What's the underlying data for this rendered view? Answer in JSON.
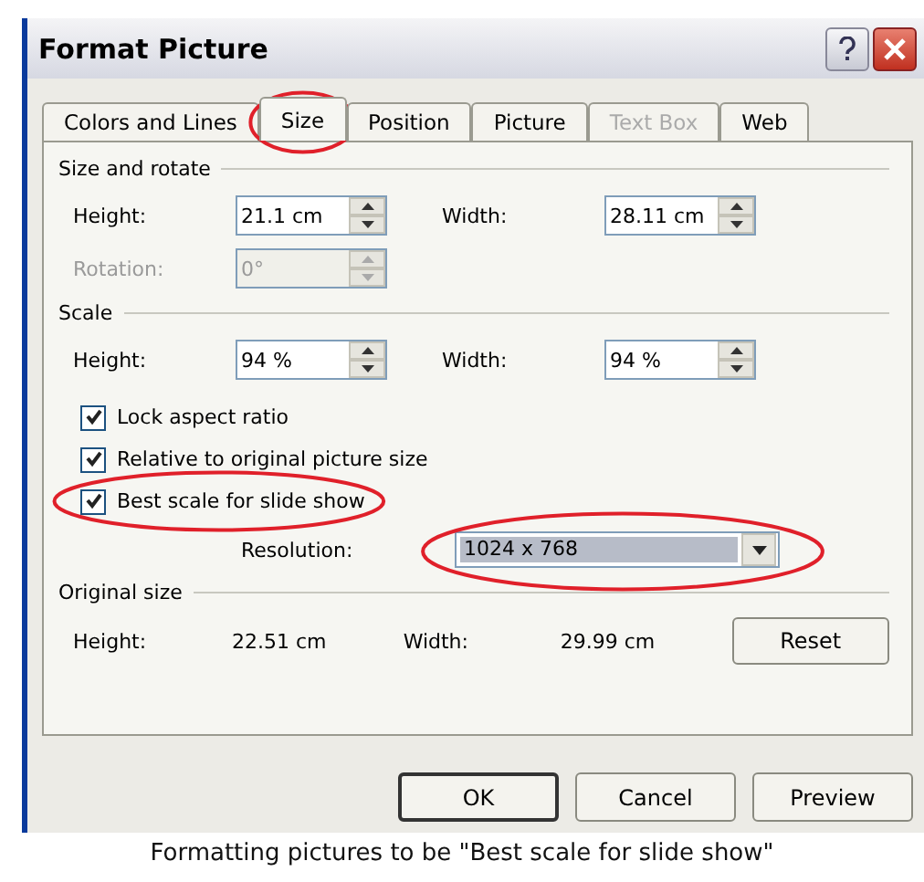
{
  "window": {
    "title": "Format Picture"
  },
  "tabs": [
    {
      "label": "Colors and Lines",
      "selected": false,
      "disabled": false,
      "circled": false
    },
    {
      "label": "Size",
      "selected": true,
      "disabled": false,
      "circled": true
    },
    {
      "label": "Position",
      "selected": false,
      "disabled": false,
      "circled": false
    },
    {
      "label": "Picture",
      "selected": false,
      "disabled": false,
      "circled": false
    },
    {
      "label": "Text Box",
      "selected": false,
      "disabled": true,
      "circled": false
    },
    {
      "label": "Web",
      "selected": false,
      "disabled": false,
      "circled": false
    }
  ],
  "size_and_rotate": {
    "heading": "Size and rotate",
    "rows": [
      [
        {
          "label": "Height:",
          "value": "21.1 cm",
          "disabled": false
        },
        {
          "label": "Width:",
          "value": "28.11 cm",
          "disabled": false
        }
      ],
      [
        {
          "label": "Rotation:",
          "value": "0°",
          "disabled": true
        }
      ]
    ]
  },
  "scale": {
    "heading": "Scale",
    "rows": [
      [
        {
          "label": "Height:",
          "value": "94 %",
          "disabled": false
        },
        {
          "label": "Width:",
          "value": "94 %",
          "disabled": false
        }
      ]
    ],
    "checkboxes": [
      {
        "label": "Lock aspect ratio",
        "checked": true,
        "circled": false
      },
      {
        "label": "Relative to original picture size",
        "checked": true,
        "circled": false
      },
      {
        "label": "Best scale for slide show",
        "checked": true,
        "circled": true
      }
    ],
    "resolution": {
      "label": "Resolution:",
      "value": "1024 x 768",
      "circled": true
    }
  },
  "original_size": {
    "heading": "Original size",
    "height_label": "Height:",
    "height": "22.51 cm",
    "width_label": "Width:",
    "width": "29.99 cm",
    "reset": "Reset"
  },
  "buttons": [
    "OK",
    "Cancel",
    "Preview"
  ],
  "caption": "Formatting pictures to be \"Best scale for slide show\""
}
